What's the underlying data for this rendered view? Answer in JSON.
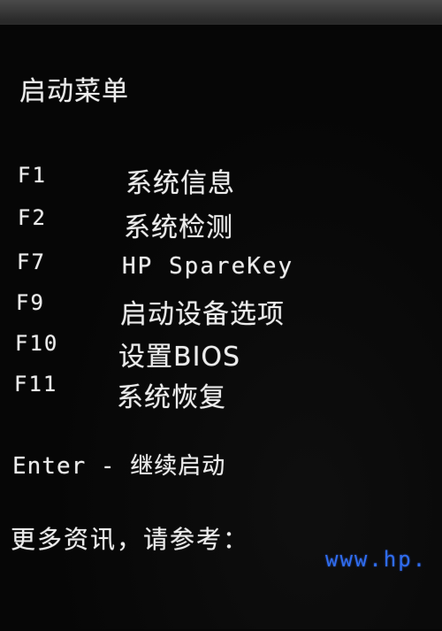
{
  "menu": {
    "title": "启动菜单",
    "items": [
      {
        "key": "F1",
        "label": "系统信息"
      },
      {
        "key": "F2",
        "label": "系统检测"
      },
      {
        "key": "F7",
        "label": "HP SpareKey"
      },
      {
        "key": "F9",
        "label": "启动设备选项"
      },
      {
        "key": "F10",
        "label": "设置BIOS"
      },
      {
        "key": "F11",
        "label": "系统恢复"
      }
    ],
    "enter_line": "Enter - 继续启动",
    "more_info": "更多资讯，请参考：",
    "url": "www.hp."
  },
  "colors": {
    "text": "#ececec",
    "link": "#2f6df0",
    "background": "#060606"
  }
}
